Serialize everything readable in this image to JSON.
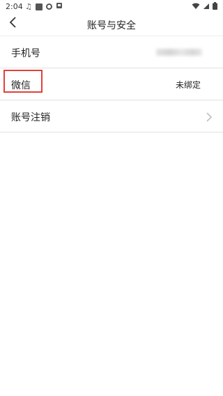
{
  "status_bar": {
    "time": "2:04",
    "icons_left": [
      "music-note-icon",
      "square-icon",
      "record-icon",
      "android-icon"
    ],
    "icons_right": [
      "wifi-icon",
      "signal-icon",
      "battery-icon"
    ]
  },
  "nav": {
    "title": "账号与安全",
    "back_icon": "chevron-left-icon"
  },
  "rows": [
    {
      "label": "手机号",
      "value": ""
    },
    {
      "label": "微信",
      "value": "未绑定"
    },
    {
      "label": "账号注销",
      "value": ""
    }
  ],
  "colors": {
    "highlight": "#e0403a",
    "divider": "#e2e2e2",
    "chevron": "#c0c0c0"
  }
}
